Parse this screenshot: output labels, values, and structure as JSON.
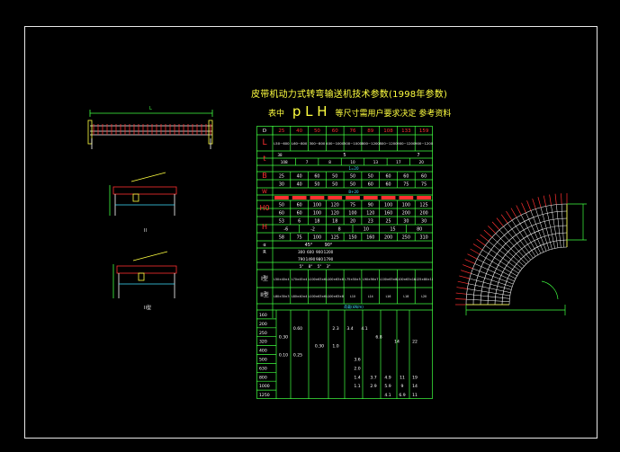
{
  "drawing": {
    "title": "皮带机动力式转弯输送机技术参数(1998年参数)",
    "subtitle_prefix": "表中",
    "subtitle_symbols": "p L H",
    "subtitle_suffix": "等尺寸需用户要求决定  参考资料",
    "view_label_2": "II",
    "view_label_3": "II型"
  },
  "table": {
    "header": [
      "D",
      "25",
      "40",
      "50",
      "60",
      "76",
      "89",
      "108",
      "133",
      "159"
    ],
    "row_L_label": "L",
    "row_L": [
      "L50~600",
      "L60~800",
      "300~800",
      "400~1000",
      "500~1000",
      "800~1200",
      "800~1200",
      "900~1200",
      "900~1200"
    ],
    "row_t_label": "t",
    "row_t1": [
      "38",
      "5",
      "7"
    ],
    "row_t2": [
      "108",
      "7",
      "8",
      "10",
      "13",
      "17",
      "20"
    ],
    "row_B_label": "B",
    "row_B_note": "1=20",
    "row_B1": [
      "25",
      "40",
      "60",
      "50",
      "50",
      "50",
      "60",
      "60",
      "60"
    ],
    "row_B2": [
      "30",
      "40",
      "50",
      "50",
      "50",
      "60",
      "60",
      "75",
      "75"
    ],
    "row_W_label": "W",
    "row_W_note": "B+20",
    "row_H0_label": "H0",
    "row_H0_1": [
      "50",
      "60",
      "100",
      "120",
      "75",
      "90",
      "100",
      "100",
      "125"
    ],
    "row_H0_2": [
      "60",
      "60",
      "100",
      "120",
      "100",
      "120",
      "160",
      "200",
      "200"
    ],
    "row_H_label": "H",
    "row_H_1": [
      "53",
      "6",
      "18",
      "18",
      "20",
      "23",
      "25",
      "30",
      "30"
    ],
    "row_H_2": [
      "-6",
      "-2",
      "8",
      "10",
      "15",
      "80"
    ],
    "row_H_3": [
      "58",
      "75",
      "100",
      "125",
      "150",
      "160",
      "200",
      "250",
      "310"
    ],
    "row_angle_label": "α",
    "row_angle": [
      "45°",
      "90°"
    ],
    "row_R_label": "R",
    "row_R": [
      "300",
      "600",
      "900",
      "1200",
      "790",
      "1490",
      "980",
      "1790"
    ],
    "row_beta": [
      "5°",
      "8°",
      "5°",
      "3°"
    ],
    "row_type1_label": "I型",
    "row_type1": [
      "L50×40×4",
      "L70×45×4",
      "L100×63×6",
      "L100×63×8",
      "L75×50×5",
      "L90×56×7",
      "L100×63×8",
      "L100×63×10",
      "L125×80×10"
    ],
    "row_type2_label": "II型",
    "row_type2": [
      "L80×30×3",
      "L80×40×4",
      "L100×63×6",
      "L100×63×8",
      "L10",
      "L14",
      "L16",
      "L18",
      "L20"
    ],
    "row_load_note": "荷载(kN/m)",
    "row_lengths": [
      "160",
      "200",
      "250",
      "320",
      "400",
      "500",
      "630",
      "800",
      "1000",
      "1250"
    ],
    "row_loads": [
      "0.30",
      "0.60",
      "0.10",
      "0.25",
      "0.30",
      "1.0",
      "2.3",
      "3.4",
      "4.1",
      "6.8",
      "14",
      "22",
      "3.6",
      "2.0",
      "1.4",
      "3.7",
      "4.9",
      "11",
      "19",
      "1.1",
      "2.9",
      "5.9",
      "9",
      "14",
      "4.1",
      "6.9",
      "11"
    ]
  },
  "views": {
    "left_label_1": "L",
    "left_label_2": "II",
    "left_label_3": "II型"
  },
  "colors": {
    "background": "#000000",
    "frame": "#e8e8e8",
    "title": "#ffff40",
    "table_lines": "#40ff40",
    "header_text": "#ff3030",
    "table_text": "#ffffff",
    "arc_lines": "#ffffff",
    "arc_rays": "#ff3030",
    "dims": "#40ff40",
    "cyan": "#40e0ff"
  }
}
